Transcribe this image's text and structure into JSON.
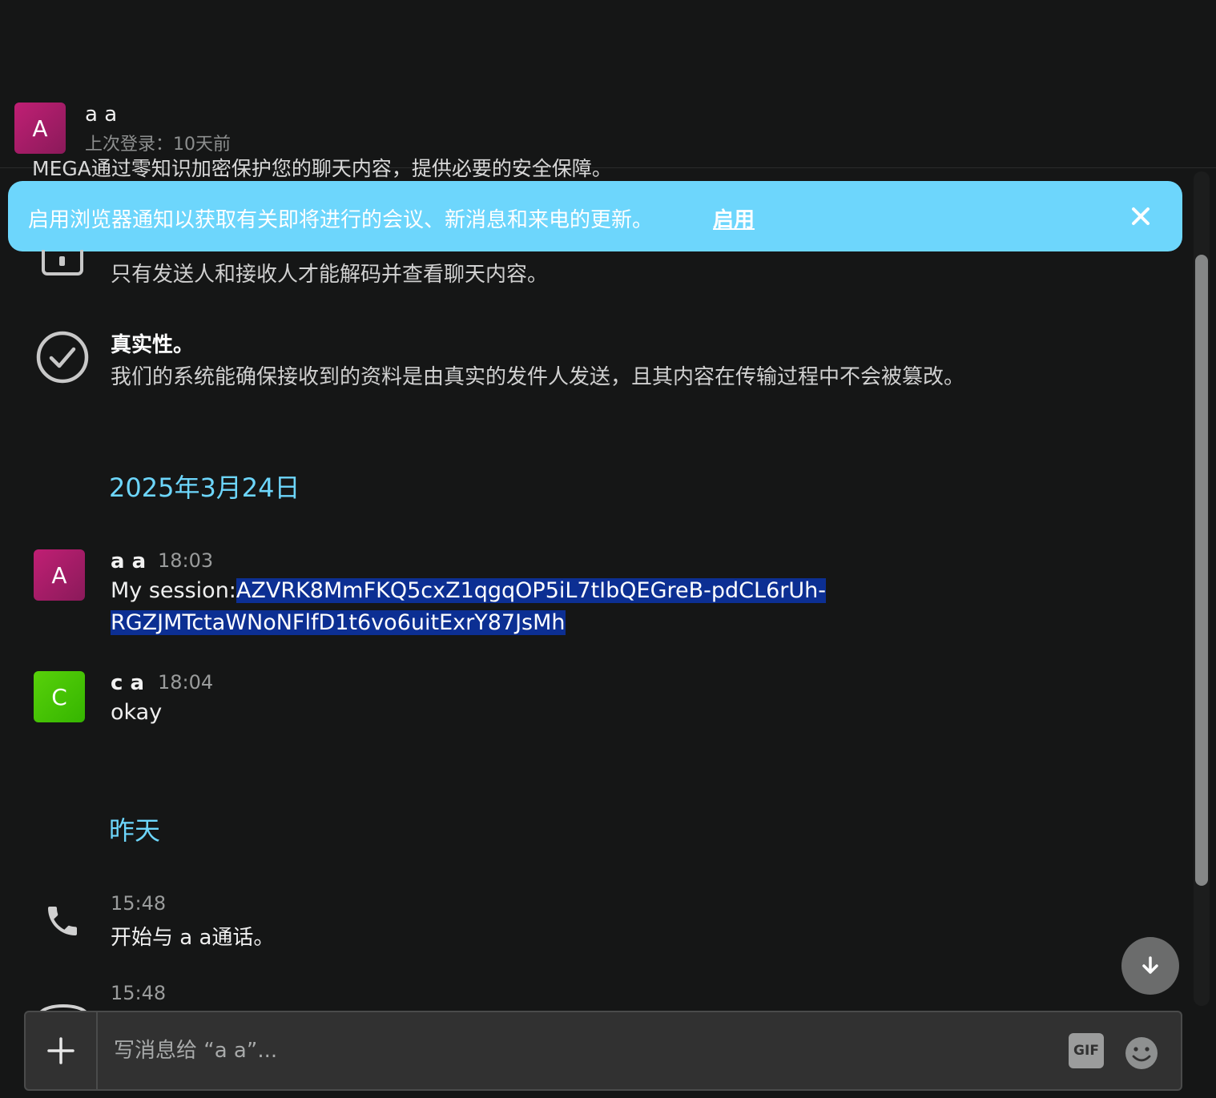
{
  "header": {
    "avatar_letter": "A",
    "name": "a a",
    "status": "上次登录：10天前"
  },
  "intro": {
    "cut_text": "MEGA通过零知识加密保护您的聊天内容，提供必要的安全保障。"
  },
  "banner": {
    "text": "启用浏览器通知以获取有关即将进行的会议、新消息和来电的更新。",
    "link": "启用",
    "color": "#6dd6fc"
  },
  "features": [
    {
      "icon": "lock-icon",
      "title": "",
      "text": "只有发送人和接收人才能解码并查看聊天内容。"
    },
    {
      "icon": "check-circle-icon",
      "title": "真实性。",
      "text": "我们的系统能确保接收到的资料是由真实的发件人发送，且其内容在传输过程中不会被篡改。"
    }
  ],
  "date_separators": [
    "2025年3月24日",
    "昨天"
  ],
  "messages": [
    {
      "avatar": "A",
      "author": "a a",
      "time": "18:03",
      "prefix": "My session:",
      "selected_line1": "AZVRK8MmFKQ5cxZ1qgqOP5iL7tIbQEGreB-pdCL6rUh-",
      "selected_line2": "RGZJMTctaWNoNFlfD1t6vo6uitExrY87JsMh"
    },
    {
      "avatar": "C",
      "author": "c a",
      "time": "18:04",
      "text": "okay"
    }
  ],
  "calls": [
    {
      "time": "15:48",
      "text": "开始与 a a通话。"
    },
    {
      "time": "15:48",
      "text": ""
    }
  ],
  "composer": {
    "placeholder": "写消息给 “a a”...",
    "gif_label": "GIF"
  },
  "colors": {
    "background": "#151616",
    "accent": "#6dd6fc",
    "avatar_a": "#c01f74",
    "avatar_c": "#35b500",
    "selection": "#0c2f93"
  }
}
